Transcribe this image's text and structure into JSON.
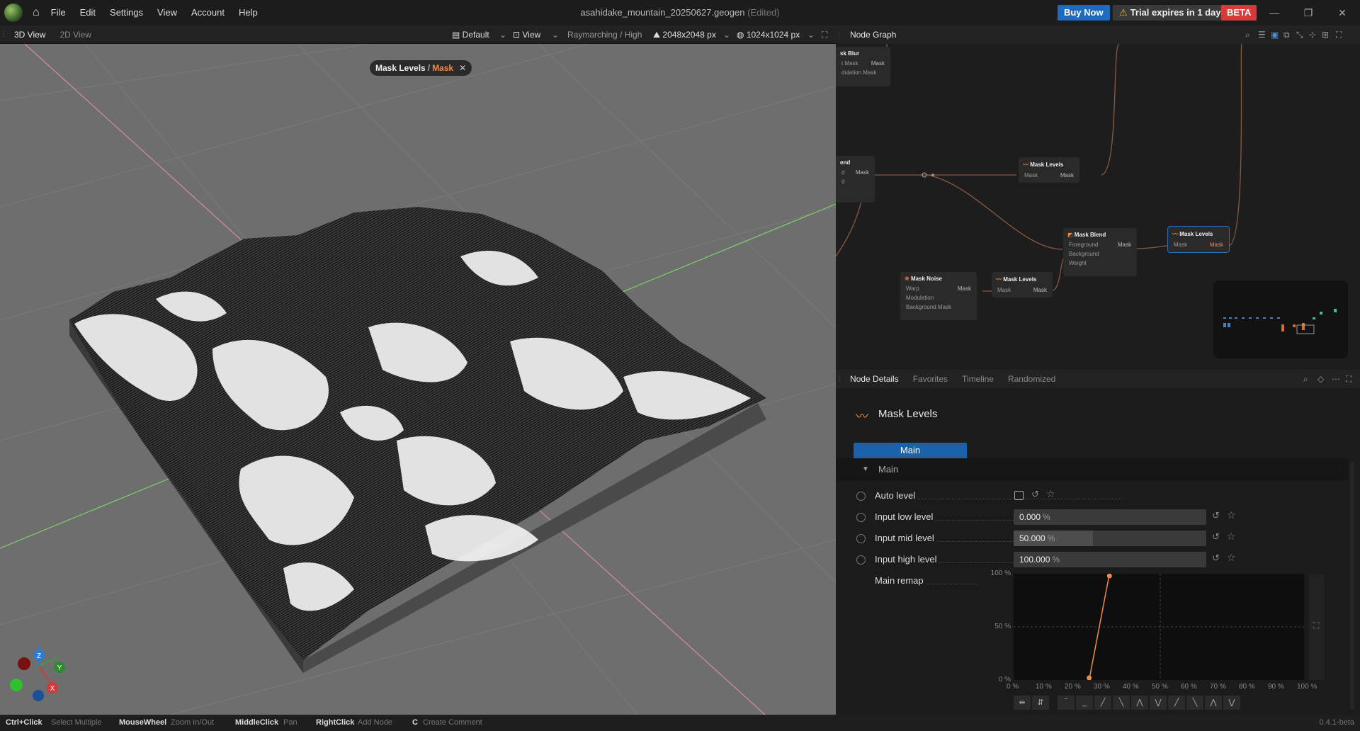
{
  "app": {
    "document_title": "asahidake_mountain_20250627.geogen",
    "edited_label": "(Edited)",
    "menu": [
      "File",
      "Edit",
      "Settings",
      "View",
      "Account",
      "Help"
    ],
    "buy_now": "Buy Now",
    "trial_text": "Trial expires in 1 days",
    "beta": "BETA",
    "version": "0.4.1-beta"
  },
  "viewport": {
    "tabs": [
      "3D View",
      "2D View"
    ],
    "active_tab": "3D View",
    "preset": "Default",
    "view_menu": "View",
    "render_mode": "Raymarching / High",
    "resolution": "2048x2048 px",
    "preview_resolution": "1024x1024 px",
    "breadcrumb": {
      "node": "Mask Levels",
      "separator": "/",
      "output": "Mask"
    },
    "gizmo": {
      "z": "Z",
      "y": "Y",
      "x": "X"
    }
  },
  "node_graph": {
    "title": "Node Graph",
    "nodes": {
      "blur": {
        "title": "sk Blur",
        "ports": [
          "t Mask",
          "dulation Mask"
        ],
        "out": "Mask"
      },
      "blend_left": {
        "title": "end",
        "ports": [
          "d",
          "d"
        ],
        "out": "Mask"
      },
      "levels_top": {
        "title": "Mask Levels",
        "in": "Mask",
        "out": "Mask"
      },
      "blend": {
        "title": "Mask Blend",
        "ports": [
          "Foreground",
          "Background",
          "Weight"
        ],
        "out": "Mask"
      },
      "levels_sel": {
        "title": "Mask Levels",
        "in": "Mask",
        "out": "Mask"
      },
      "noise": {
        "title": "Mask Noise",
        "ports": [
          "Warp",
          "Modulation",
          "Background Mask"
        ],
        "out": "Mask"
      },
      "levels_bottom": {
        "title": "Mask Levels",
        "in": "Mask",
        "out": "Mask"
      }
    }
  },
  "details": {
    "tabs": [
      "Node Details",
      "Favorites",
      "Timeline",
      "Randomized"
    ],
    "node_title": "Mask Levels",
    "main_tab": "Main",
    "section": "Main",
    "params": {
      "auto_level": {
        "label": "Auto level",
        "checked": false
      },
      "input_low": {
        "label": "Input low level",
        "value": "0.000",
        "unit": "%",
        "fraction": 0.0
      },
      "input_mid": {
        "label": "Input mid level",
        "value": "50.000",
        "unit": "%",
        "fraction": 0.5
      },
      "input_high": {
        "label": "Input high level",
        "value": "100.000",
        "unit": "%",
        "fraction": 1.0
      },
      "remap": {
        "label": "Main remap"
      }
    },
    "curve": {
      "y_labels": [
        "100 %",
        "50 %",
        "0 %"
      ],
      "x_labels": [
        "0 %",
        "10 %",
        "20 %",
        "30 %",
        "40 %",
        "50 %",
        "60 %",
        "70 %",
        "80 %",
        "90 %",
        "100 %"
      ],
      "points": [
        [
          26,
          0
        ],
        [
          33,
          100
        ]
      ]
    }
  },
  "statusbar": [
    {
      "key": "Ctrl+Click",
      "action": "Select Multiple"
    },
    {
      "key": "MouseWheel",
      "action": "Zoom In/Out"
    },
    {
      "key": "MiddleClick",
      "action": "Pan"
    },
    {
      "key": "RightClick",
      "action": "Add Node"
    },
    {
      "key": "C",
      "action": "Create Comment"
    }
  ],
  "colors": {
    "accent": "#f08a4b",
    "select": "#1b62ad",
    "buy": "#1b6bc1",
    "beta": "#d83a3a"
  }
}
